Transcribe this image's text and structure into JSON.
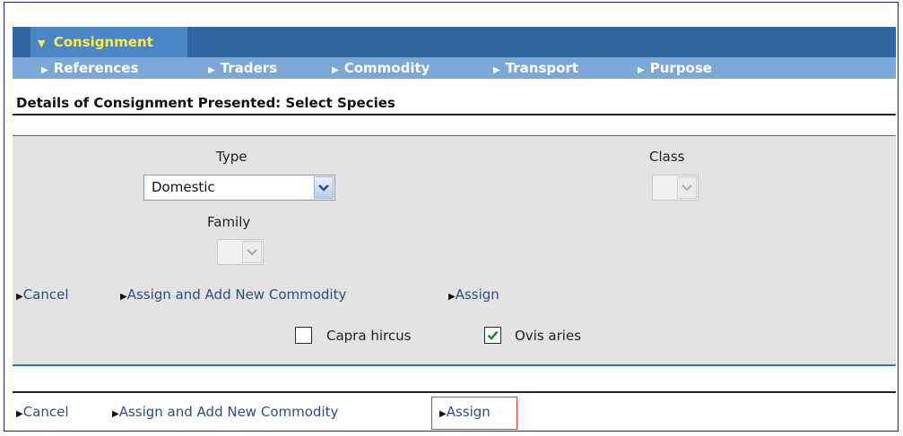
{
  "nav": {
    "main_tab": "Consignment",
    "sub_items": [
      "References",
      "Traders",
      "Commodity",
      "Transport",
      "Purpose"
    ]
  },
  "page": {
    "title": "Details of Consignment Presented: Select Species"
  },
  "form": {
    "type_label": "Type",
    "type_value": "Domestic",
    "class_label": "Class",
    "class_value": "",
    "family_label": "Family",
    "family_value": ""
  },
  "actions": {
    "cancel": "Cancel",
    "assign_add": "Assign and Add New Commodity",
    "assign": "Assign"
  },
  "species": [
    {
      "label": "Capra hircus",
      "checked": false
    },
    {
      "label": "Ovis aries",
      "checked": true
    }
  ],
  "colors": {
    "nav_bar": "#2f67a3",
    "active_tab": "#4a86c5",
    "active_tab_text": "#ffea3d",
    "sub_bar": "#7aa8d8",
    "link": "#2a4f86",
    "highlight": "#e53935"
  }
}
